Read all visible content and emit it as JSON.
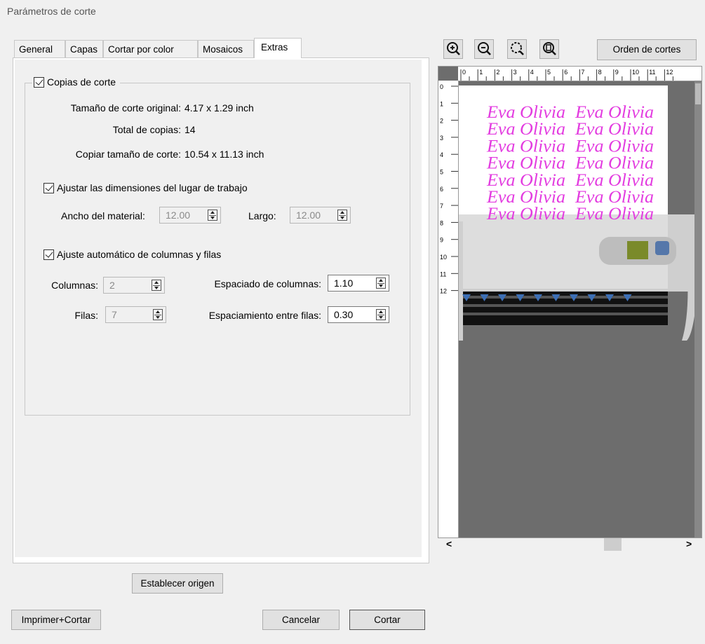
{
  "window": {
    "title": "Parámetros de corte"
  },
  "tabs": [
    {
      "label": "General"
    },
    {
      "label": "Capas"
    },
    {
      "label": "Cortar por color"
    },
    {
      "label": "Mosaicos"
    },
    {
      "label": "Extras"
    }
  ],
  "copies": {
    "label": "Copias de corte",
    "checked": true,
    "original_size_label": "Tamaño de corte original:",
    "original_size_value": "4.17 x 1.29 inch",
    "total_label": "Total de copias:",
    "total_value": "14",
    "copy_size_label": "Copiar tamaño de corte:",
    "copy_size_value": "10.54 x 11.13 inch"
  },
  "workspace": {
    "label": "Ajustar las dimensiones del lugar de trabajo",
    "checked": true,
    "width_label": "Ancho del material:",
    "width_value": "12.00",
    "length_label": "Largo:",
    "length_value": "12.00"
  },
  "auto_grid": {
    "label": "Ajuste automático de columnas y filas",
    "checked": true,
    "columns_label": "Columnas:",
    "columns_value": "2",
    "col_spacing_label": "Espaciado de columnas:",
    "col_spacing_value": "1.10",
    "rows_label": "Filas:",
    "rows_value": "7",
    "row_spacing_label": "Espaciamiento entre filas:",
    "row_spacing_value": "0.30"
  },
  "buttons": {
    "set_origin": "Establecer origen",
    "print_cut": "Imprimer+Cortar",
    "cancel": "Cancelar",
    "cut": "Cortar",
    "cut_order": "Orden de cortes"
  },
  "zoom_icons": [
    "zoom-in-icon",
    "zoom-out-icon",
    "zoom-fit-icon",
    "zoom-page-icon"
  ],
  "preview": {
    "design_text": "Eva Olivia",
    "design_color": "#e33ce0",
    "ruler_top": [
      "0",
      "1",
      "2",
      "3",
      "4",
      "5",
      "6",
      "7",
      "8",
      "9",
      "10",
      "11",
      "12"
    ],
    "ruler_left": [
      "0",
      "1",
      "2",
      "3",
      "4",
      "5",
      "6",
      "7",
      "8",
      "9",
      "10",
      "11",
      "12"
    ]
  },
  "scrollbar": {
    "left_arrow": "<",
    "right_arrow": ">"
  }
}
